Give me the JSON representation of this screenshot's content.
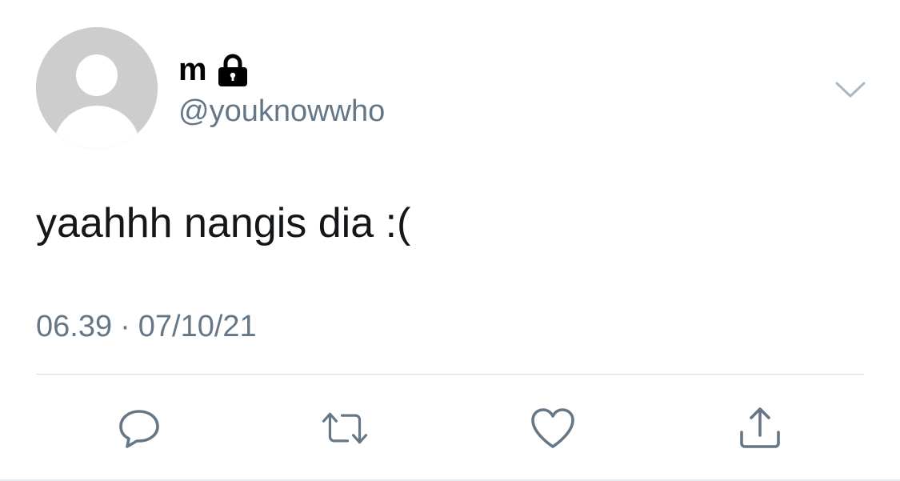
{
  "user": {
    "display_name": "m",
    "handle": "@youknowwho",
    "protected_icon": "lock-icon",
    "avatar": "default-avatar-icon"
  },
  "tweet": {
    "text": "yaahhh nangis dia :(",
    "time": "06.39",
    "separator": "·",
    "date": "07/10/21"
  },
  "actions": {
    "menu": "chevron-down-icon",
    "reply": "reply-icon",
    "retweet": "retweet-icon",
    "like": "heart-icon",
    "share": "share-icon"
  },
  "colors": {
    "secondary_text": "#657786",
    "icon": "#657786",
    "avatar_bg": "#cdcdcd",
    "divider": "#dadfe3"
  }
}
